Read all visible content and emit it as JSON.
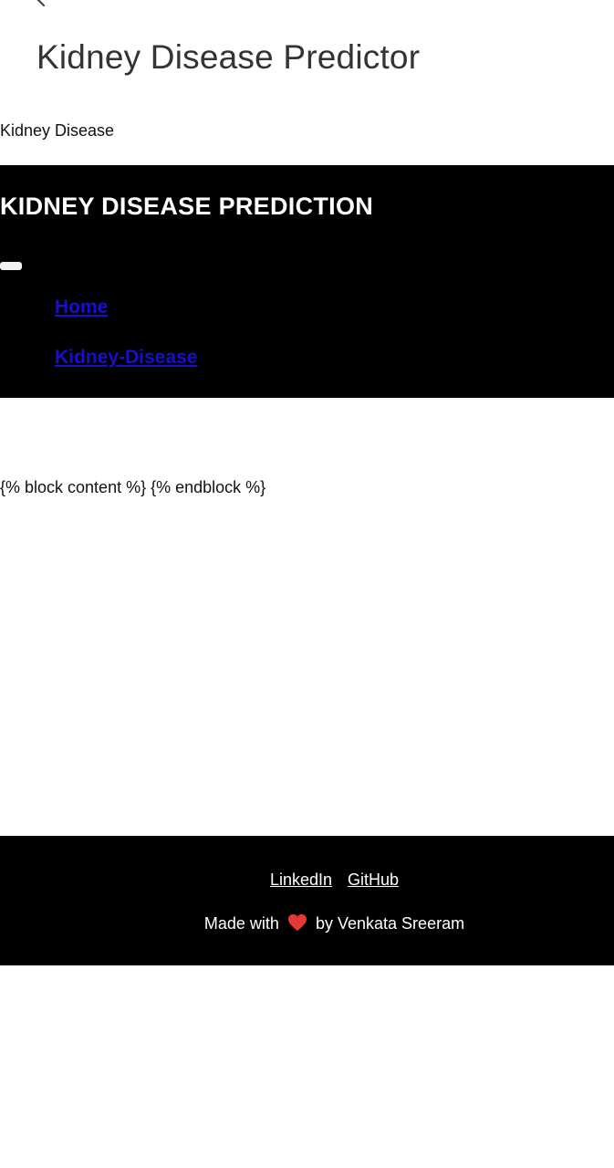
{
  "app": {
    "title": "Kidney Disease Predictor"
  },
  "document": {
    "title": "Kidney Disease"
  },
  "header": {
    "brand": "KIDNEY DISEASE PREDICTION",
    "toggle_icon": "menu-toggle-icon",
    "nav_items": [
      {
        "label": "Home"
      },
      {
        "label": "Kidney-Disease"
      }
    ]
  },
  "main": {
    "template_text": "{% block content %} {% endblock %}"
  },
  "footer": {
    "links": [
      {
        "label": "LinkedIn"
      },
      {
        "label": "GitHub"
      }
    ],
    "credit_prefix": "Made with",
    "credit_suffix": "by Venkata Sreeram",
    "heart_icon": "heart-icon"
  },
  "colors": {
    "bar_background": "#000000",
    "nav_link": "#1a0dcc",
    "heart": "#e53935"
  }
}
